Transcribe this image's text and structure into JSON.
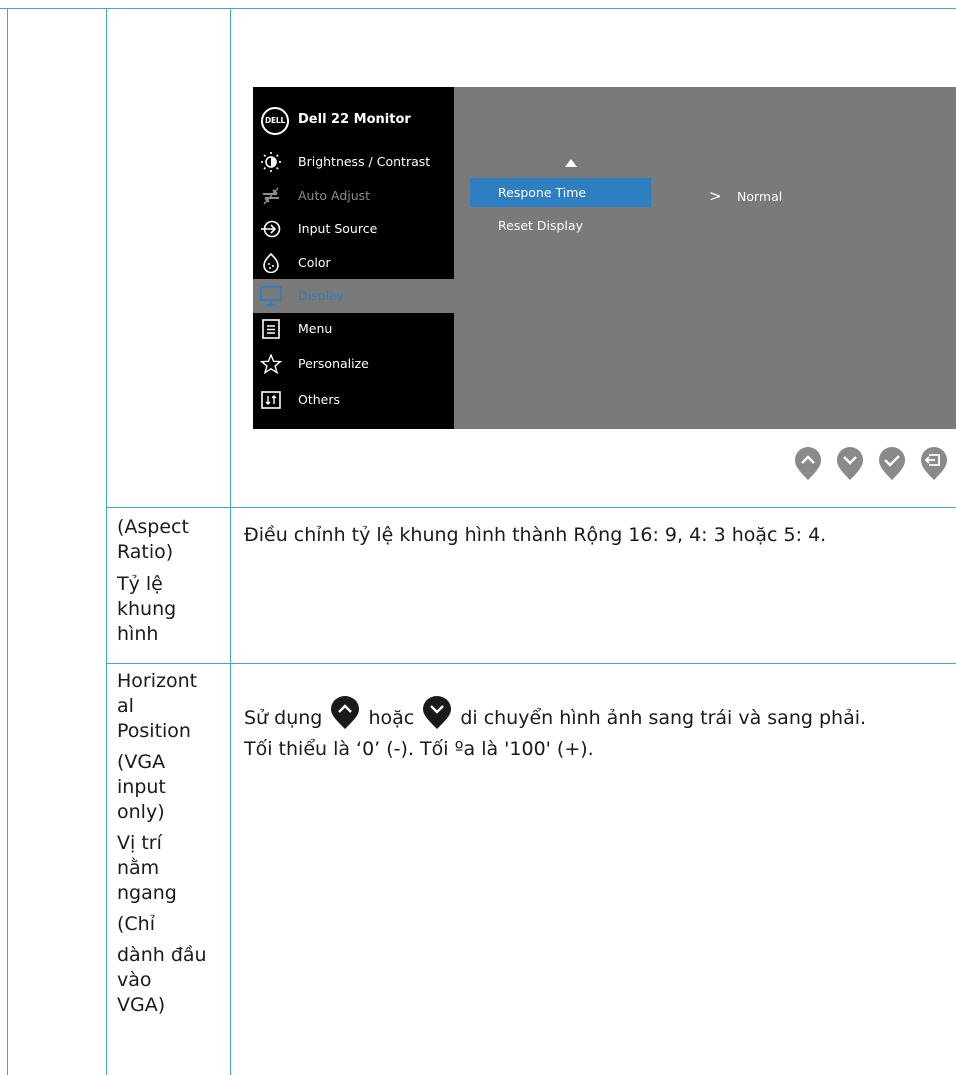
{
  "osd": {
    "brand_logo": "DELL",
    "title": "Dell 22 Monitor",
    "menu": [
      {
        "label": "Brightness / Contrast",
        "icon": "brightness-icon"
      },
      {
        "label": "Auto Adjust",
        "icon": "auto-adjust-icon"
      },
      {
        "label": "Input Source",
        "icon": "input-source-icon"
      },
      {
        "label": "Color",
        "icon": "color-icon"
      },
      {
        "label": "Display",
        "icon": "display-icon"
      },
      {
        "label": "Menu",
        "icon": "menu-icon"
      },
      {
        "label": "Personalize",
        "icon": "star-icon"
      },
      {
        "label": "Others",
        "icon": "others-icon"
      }
    ],
    "selected_menu": "Display",
    "submenu": [
      {
        "label": "Respone Time"
      },
      {
        "label": "Reset Display"
      }
    ],
    "value_arrow": ">",
    "value": "Normal",
    "nav_buttons": [
      "up-icon",
      "down-icon",
      "check-icon",
      "back-icon"
    ]
  },
  "rows": [
    {
      "label_lines": [
        "(Aspect",
        "Ratio)",
        "Tỷ  lệ",
        "khung",
        "hình"
      ],
      "description": "Điều chỉnh tỷ lệ khung hình thành Rộng 16: 9, 4: 3 hoặc 5: 4."
    },
    {
      "label_lines": [
        "Horizont",
        "al",
        "Position",
        "(VGA",
        "input",
        "only)",
        "Vị  trí",
        "nằm",
        "ngang",
        "(Chỉ",
        "dành đầu",
        "vào",
        "VGA)"
      ],
      "desc_part1": "Sử dụng",
      "desc_part2": "hoặc",
      "desc_part3": "di chuyển hình ảnh sang trái và sang phải.",
      "desc_line2": "Tối thiểu là ‘0’ (-). Tối ºa là '100' (+)."
    }
  ],
  "colors": {
    "rule": "#3fa9c9",
    "osd_bg": "#7a7a7a",
    "osd_menu_bg": "#000000",
    "osd_highlight": "#2e7fc2",
    "button_gray": "#8a8a8a"
  }
}
